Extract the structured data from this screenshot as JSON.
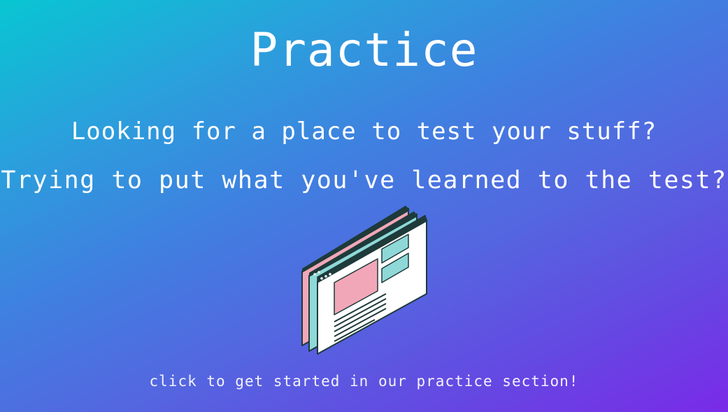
{
  "hero": {
    "title": "Practice",
    "line1": "Looking for a place to test your stuff?",
    "line2": "Trying to put what you've learned to the test?",
    "cta": "click to get started in our practice section!"
  },
  "colors": {
    "gradient_start": "#08c6d2",
    "gradient_end": "#7a2ae8",
    "text": "#ffffff",
    "illustration_pink": "#f2a7b8",
    "illustration_teal": "#8fd8d8",
    "illustration_dark": "#1e3a3a"
  },
  "illustration": {
    "icon": "browser-windows-illustration"
  }
}
